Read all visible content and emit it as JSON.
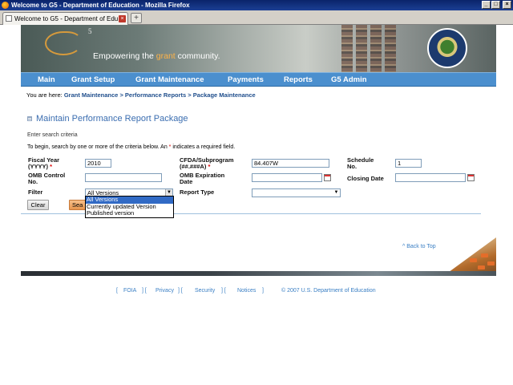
{
  "window": {
    "title": "Welcome to G5 - Department of Education - Mozilla Firefox",
    "tab_label": "Welcome to G5 - Department of Edu...",
    "new_tab_symbol": "+",
    "tab_close_symbol": "×"
  },
  "banner": {
    "sup": "5",
    "tagline_pre": "Empowering the ",
    "tagline_accent": "grant",
    "tagline_post": " community."
  },
  "nav": {
    "items": [
      {
        "label": "Main"
      },
      {
        "label": "Grant Setup"
      },
      {
        "label": "Grant Maintenance"
      },
      {
        "label": "Payments"
      },
      {
        "label": "Reports"
      },
      {
        "label": "G5 Admin"
      }
    ]
  },
  "breadcrumb": {
    "prefix": "You are here: ",
    "items": [
      "Grant Maintenance",
      "Performance Reports",
      "Package Maintenance"
    ],
    "separator": " > "
  },
  "page": {
    "title": "Maintain Performance Report Package",
    "hint": "Enter search criteria",
    "instructions_pre": "To begin, search by one or more of the criteria below.  An ",
    "required_mark": "*",
    "instructions_post": " indicates a required field."
  },
  "form": {
    "fiscal_year": {
      "label_line1": "Fiscal Year",
      "label_line2": "(YYYY)",
      "value": "2010"
    },
    "cfda": {
      "label_line1": "CFDA/Subprogram",
      "label_line2": "(##.###A)",
      "value": "84.407W"
    },
    "schedule": {
      "label_line1": "Schedule",
      "label_line2": "No.",
      "value": "1"
    },
    "omb_control": {
      "label_line1": "OMB Control",
      "label_line2": "No.",
      "value": ""
    },
    "omb_expiration": {
      "label_line1": "OMB Expiration",
      "label_line2": "Date",
      "value": ""
    },
    "closing_date": {
      "label": "Closing Date",
      "value": ""
    },
    "filter": {
      "label": "Filter",
      "selected": "All Versions",
      "options": [
        "All Versions",
        "Currently updated Version",
        "Published version"
      ]
    },
    "report_type": {
      "label": "Report Type",
      "selected": ""
    },
    "clear_label": "Clear",
    "search_label": "Sea"
  },
  "back_to_top": "^ Back to Top",
  "footer": {
    "links": [
      "FOIA",
      "Privacy",
      "Security",
      "Notices"
    ],
    "copyright": "©  2007  U.S.  Department  of  Education"
  },
  "icons": {
    "browser": "firefox-icon",
    "calendar": "calendar-icon",
    "seal": "department-of-education-seal"
  },
  "colors": {
    "nav_bg": "#4b8fce",
    "link": "#1f4e8c",
    "title": "#3a6db0",
    "required": "#dd0000",
    "dropdown_highlight": "#316ac5"
  }
}
